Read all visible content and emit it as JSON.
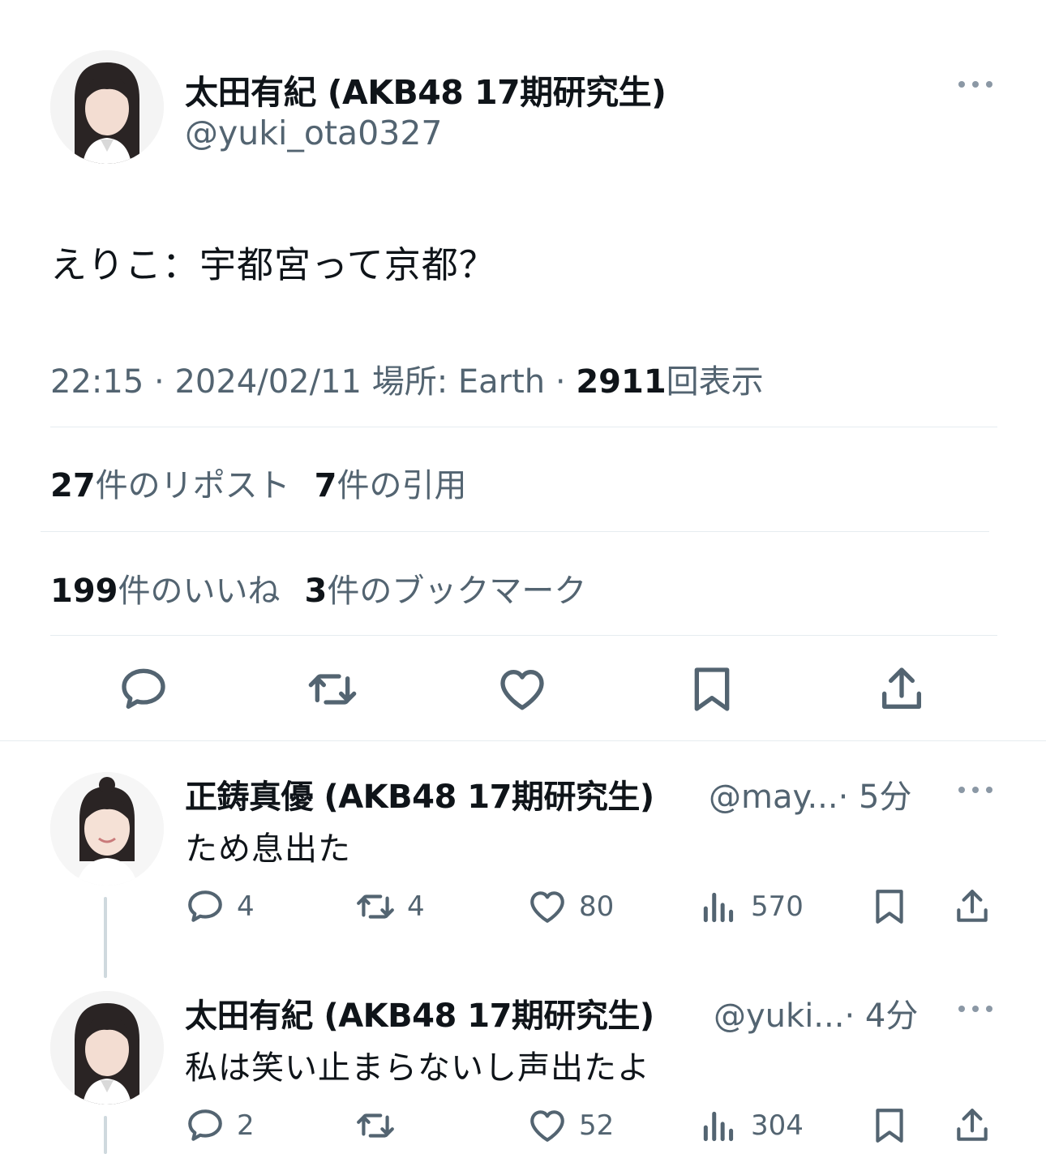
{
  "main_tweet": {
    "name": "太田有紀 (AKB48 17期研究生)",
    "handle": "@yuki_ota0327",
    "text": "えりこ：宇都宮って京都？",
    "time": "22:15",
    "date": "2024/02/11",
    "location": "場所: Earth",
    "views_count": "2911",
    "views_label": "回表示",
    "separator": "·",
    "reposts_count": "27",
    "reposts_label": "件のリポスト",
    "quotes_count": "7",
    "quotes_label": "件の引用",
    "likes_count": "199",
    "likes_label": "件のいいね",
    "bookmarks_count": "3",
    "bookmarks_label": "件のブックマーク"
  },
  "replies": [
    {
      "name": "正鋳真優 (AKB48 17期研究生)",
      "handle": "@may...",
      "time": "· 5分",
      "text": "ため息出た",
      "replies": "4",
      "reposts": "4",
      "likes": "80",
      "views": "570"
    },
    {
      "name": "太田有紀 (AKB48 17期研究生)",
      "handle": "@yuki...",
      "time": "· 4分",
      "text": "私は笑い止まらないし声出たよ",
      "replies": "2",
      "reposts": "",
      "likes": "52",
      "views": "304"
    }
  ],
  "icons": [
    "more-icon",
    "reply-icon",
    "repost-icon",
    "like-icon",
    "bookmark-icon",
    "share-icon",
    "views-icon"
  ],
  "colors": {
    "text": "#0f1419",
    "muted": "#536471",
    "divider": "#e6ecf0",
    "thread_line": "#cfd9de"
  }
}
